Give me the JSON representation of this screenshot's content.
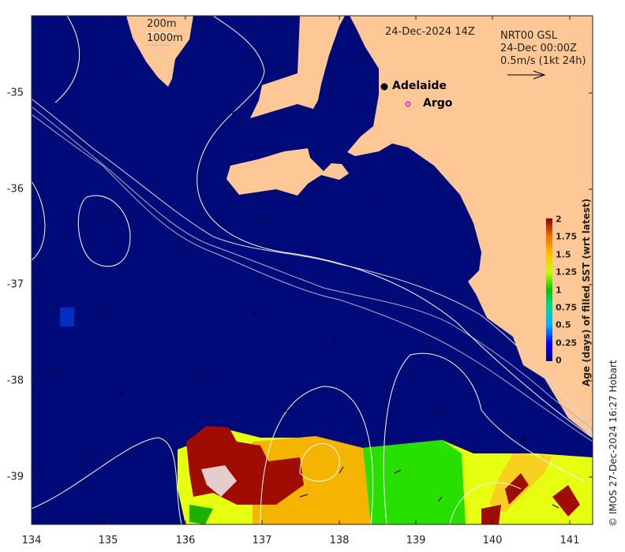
{
  "map": {
    "date_label": "24-Dec-2024 14Z",
    "product": {
      "line1": "NRT00 GSL",
      "line2": "24-Dec 00:00Z",
      "line3": "0.5m/s (1kt 24h)"
    },
    "contour_legend": {
      "shallow": "200m",
      "deep": "1000m"
    },
    "places": [
      {
        "name": "Adelaide",
        "marker": "black-dot"
      },
      {
        "name": "Argo",
        "marker": "magenta-circle"
      }
    ],
    "x_ticks": [
      "134",
      "135",
      "136",
      "137",
      "138",
      "139",
      "140",
      "141"
    ],
    "y_ticks": [
      "-35",
      "-36",
      "-37",
      "-38",
      "-39"
    ],
    "colorbar": {
      "title": "Age (days) of filled SST (wrt latest)",
      "ticks": [
        "2",
        "1.75",
        "1.5",
        "1.25",
        "1",
        "0.75",
        "0.5",
        "0.25",
        "0"
      ],
      "range": [
        0,
        2
      ]
    },
    "credit": "© IMOS 27-Dec-2024 16:27 Hobart",
    "colors": {
      "ocean": "#000a78",
      "land": "#fdc896",
      "argo": "#ff00ff"
    }
  }
}
